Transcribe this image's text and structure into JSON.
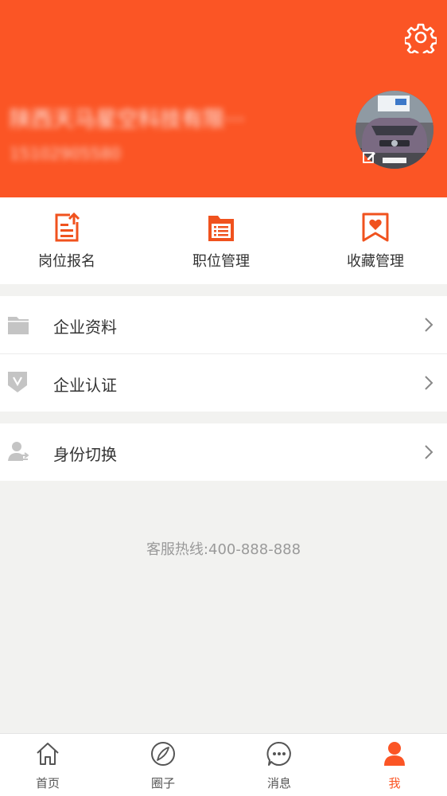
{
  "header": {
    "company_name": "陕西天马星空科技有限···",
    "phone": "15102905580"
  },
  "quick_actions": [
    {
      "label": "岗位报名",
      "icon": "document-upload-icon"
    },
    {
      "label": "职位管理",
      "icon": "folder-list-icon"
    },
    {
      "label": "收藏管理",
      "icon": "heart-bookmark-icon"
    }
  ],
  "menu": [
    {
      "label": "企业资料",
      "icon": "folder-icon"
    },
    {
      "label": "企业认证",
      "icon": "verified-shield-icon"
    },
    {
      "label": "身份切换",
      "icon": "user-switch-icon"
    }
  ],
  "hotline": "客服热线:400-888-888",
  "tabs": [
    {
      "label": "首页",
      "icon": "home-icon"
    },
    {
      "label": "圈子",
      "icon": "compass-icon"
    },
    {
      "label": "消息",
      "icon": "chat-icon"
    },
    {
      "label": "我",
      "icon": "user-icon",
      "active": true
    }
  ],
  "colors": {
    "accent": "#fb5525",
    "menu_icon": "#c4c4c4"
  }
}
